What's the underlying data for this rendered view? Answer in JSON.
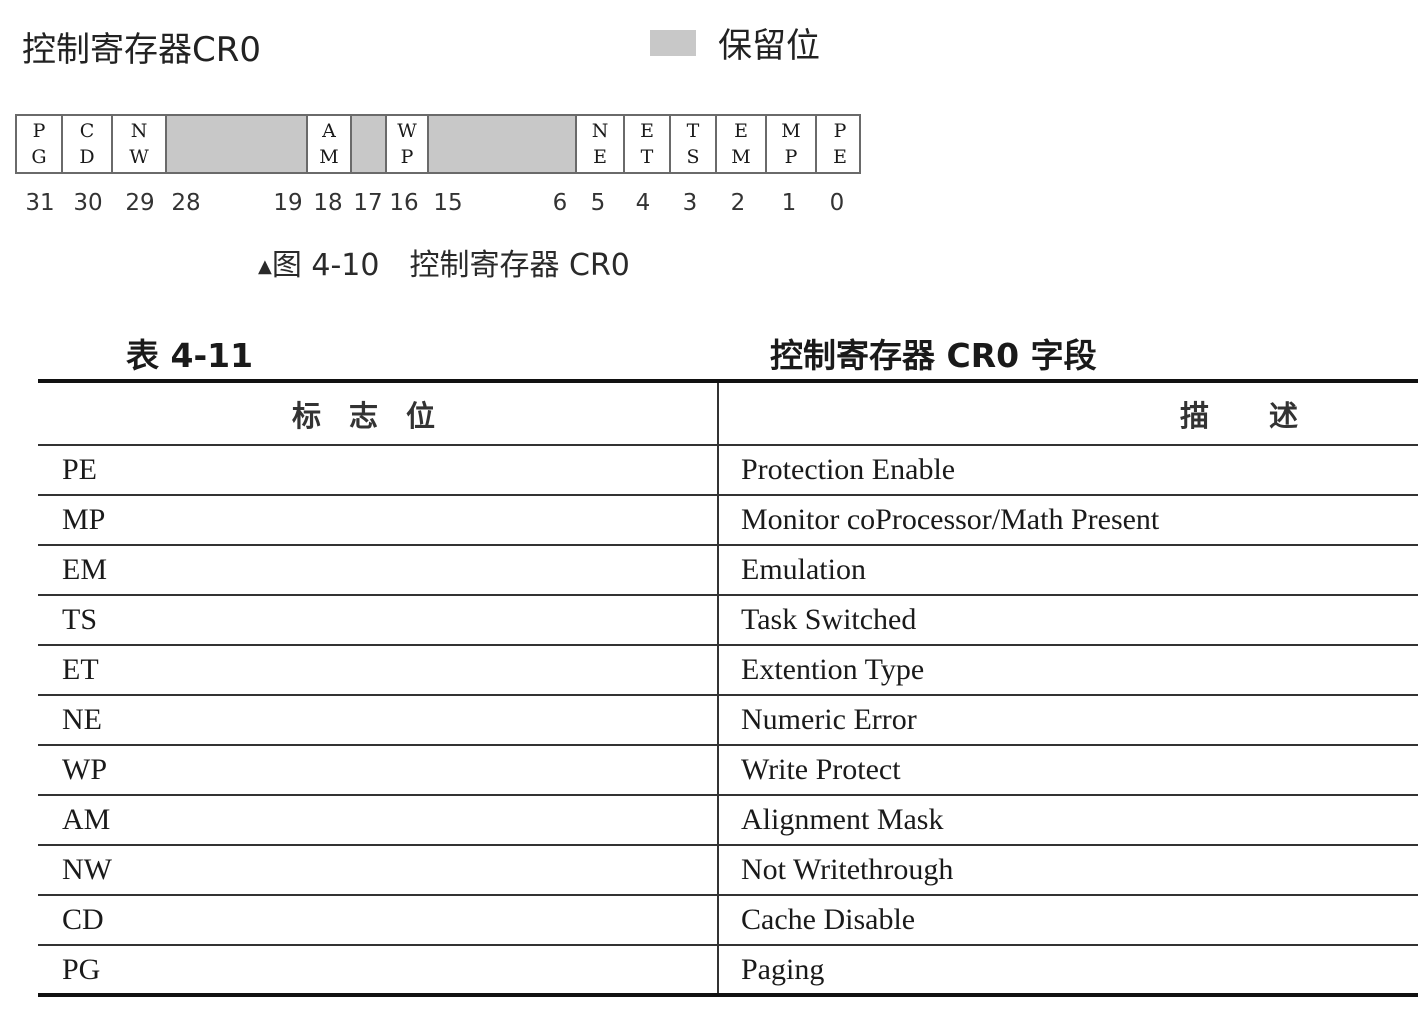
{
  "diagram": {
    "title": "控制寄存器CR0",
    "legend": {
      "label": "保留位",
      "swatch_color": "#c8c8c8"
    },
    "fields": [
      {
        "top": "P",
        "bottom": "G"
      },
      {
        "top": "C",
        "bottom": "D"
      },
      {
        "top": "N",
        "bottom": "W"
      },
      {
        "top": "",
        "bottom": "",
        "reserved": true
      },
      {
        "top": "A",
        "bottom": "M"
      },
      {
        "top": "",
        "bottom": "",
        "reserved": true
      },
      {
        "top": "W",
        "bottom": "P"
      },
      {
        "top": "",
        "bottom": "",
        "reserved": true
      },
      {
        "top": "N",
        "bottom": "E"
      },
      {
        "top": "E",
        "bottom": "T"
      },
      {
        "top": "T",
        "bottom": "S"
      },
      {
        "top": "E",
        "bottom": "M"
      },
      {
        "top": "M",
        "bottom": "P"
      },
      {
        "top": "P",
        "bottom": "E"
      }
    ],
    "bit_labels": [
      "31",
      "30",
      "29",
      "28",
      "19",
      "18",
      "17",
      "16",
      "15",
      "6",
      "5",
      "4",
      "3",
      "2",
      "1",
      "0"
    ],
    "caption": {
      "marker": "▲",
      "text": "图 4-10　控制寄存器 CR0"
    }
  },
  "table": {
    "number": "表 4-11",
    "title": "控制寄存器 CR0 字段",
    "headers": [
      "标志位",
      "描述"
    ],
    "rows": [
      {
        "flag": "PE",
        "desc": "Protection Enable"
      },
      {
        "flag": "MP",
        "desc": "Monitor coProcessor/Math Present"
      },
      {
        "flag": "EM",
        "desc": "Emulation"
      },
      {
        "flag": "TS",
        "desc": "Task Switched"
      },
      {
        "flag": "ET",
        "desc": "Extention Type"
      },
      {
        "flag": "NE",
        "desc": "Numeric Error"
      },
      {
        "flag": "WP",
        "desc": "Write Protect"
      },
      {
        "flag": "AM",
        "desc": "Alignment Mask"
      },
      {
        "flag": "NW",
        "desc": "Not Writethrough"
      },
      {
        "flag": "CD",
        "desc": "Cache Disable"
      },
      {
        "flag": "PG",
        "desc": "Paging"
      }
    ]
  }
}
